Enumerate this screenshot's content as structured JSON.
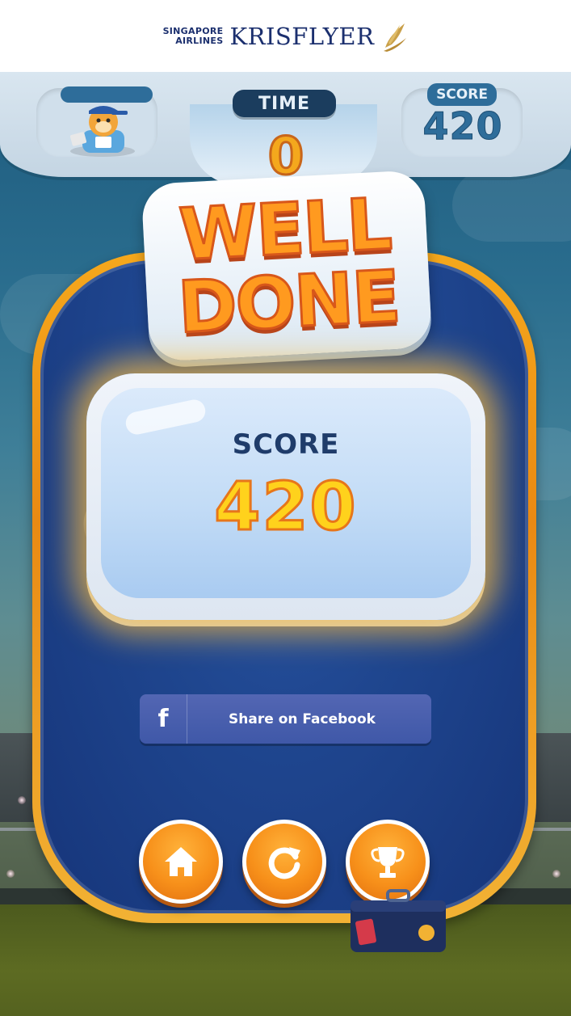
{
  "header": {
    "airline_line1": "SINGAPORE",
    "airline_line2": "AIRLINES",
    "program_name": "KRISFLYER",
    "logo_icon": "bird-icon"
  },
  "hud": {
    "player_name": "",
    "time_label": "TIME",
    "time_value": "0",
    "score_label": "SCORE",
    "score_value": "420"
  },
  "result": {
    "headline_line1": "WELL",
    "headline_line2": "DONE",
    "score_label": "SCORE",
    "score_value": "420"
  },
  "actions": {
    "facebook_icon": "f",
    "facebook_label": "Share on Facebook",
    "home_icon": "home-icon",
    "replay_icon": "replay-icon",
    "leaderboard_icon": "trophy-icon"
  },
  "colors": {
    "brand_navy": "#1b2f6e",
    "accent_orange": "#f7901a",
    "card_blue": "#1f468f",
    "facebook_blue": "#4a5fae"
  }
}
